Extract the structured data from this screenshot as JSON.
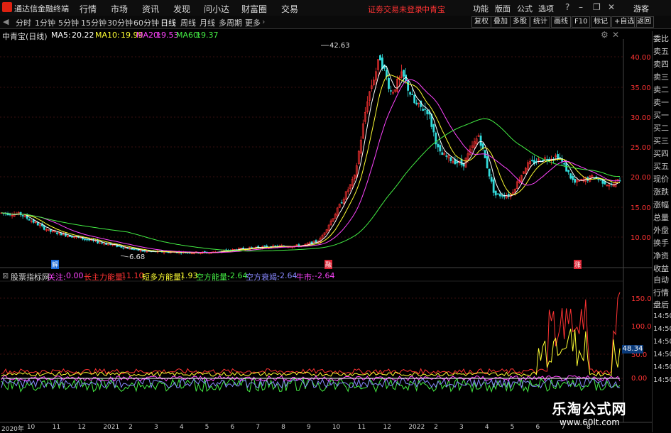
{
  "topbar": {
    "app_name": "通达信金融终端",
    "menus": [
      "行情",
      "市场",
      "资讯",
      "发现",
      "问小达",
      "财富圈",
      "交易"
    ],
    "status_text": "证劵交易未登录",
    "stock_name": "中青宝",
    "right_menus": [
      "功能",
      "版面",
      "公式",
      "选项"
    ],
    "visitor": "游客"
  },
  "toolbar": {
    "periods": [
      "分时",
      "1分钟",
      "5分钟",
      "15分钟",
      "30分钟",
      "60分钟",
      "日线",
      "周线",
      "月线",
      "多周期",
      "更多"
    ],
    "active_period": "日线",
    "right_buttons": [
      "复权",
      "叠加",
      "多股",
      "统计",
      "画线",
      "F10",
      "标记",
      "+自选",
      "返回"
    ]
  },
  "main_chart": {
    "title": "中青宝(日线)",
    "ma": [
      {
        "label": "MA5:",
        "value": "20.22",
        "color": "#ffffff"
      },
      {
        "label": "MA10:",
        "value": "19.99",
        "color": "#ffff33"
      },
      {
        "label": "MA20:",
        "value": "19.53",
        "color": "#ff44ff"
      },
      {
        "label": "MA60:",
        "value": "19.37",
        "color": "#44ee44"
      }
    ],
    "high_label": "42.63",
    "low_label": "6.68",
    "y_ticks": [
      "40.00",
      "35.00",
      "30.00",
      "25.00",
      "20.00",
      "15.00",
      "10.00"
    ],
    "tags": [
      "解",
      "融",
      "涨"
    ]
  },
  "side_panel": {
    "top_labels": [
      "委比",
      "卖五",
      "卖四",
      "卖三",
      "卖二",
      "卖一",
      "买一",
      "买二",
      "买三",
      "买四",
      "买五",
      "现价",
      "涨跌",
      "涨幅",
      "总量",
      "外盘",
      "换手",
      "净资",
      "收益"
    ],
    "bottom_labels": [
      "自动",
      "行情",
      "盘后",
      "14:50",
      "14:50",
      "14:50",
      "14:50",
      "14:50",
      "14:50"
    ]
  },
  "indicator": {
    "name": "股票指标网",
    "items": [
      {
        "label": "关注:",
        "value": "0.00",
        "color": "#ff44ff"
      },
      {
        "label": "长主力能量:",
        "value": "11.10",
        "color": "#ff3333"
      },
      {
        "label": "短多方能量:",
        "value": "1.93",
        "color": "#ffff33"
      },
      {
        "label": "空方能量:",
        "value": "-2.64",
        "color": "#44ee44"
      },
      {
        "label": "空方衰竭:",
        "value": "-2.64",
        "color": "#8888ff"
      },
      {
        "label": "牛市:",
        "value": "-2.64",
        "color": "#ff44ff"
      }
    ],
    "y_ticks": [
      "150.0",
      "100.0",
      "50.0",
      "0.00"
    ],
    "current_value": "48.34"
  },
  "x_axis": {
    "labels": [
      "2020年",
      "10",
      "11",
      "12",
      "2021",
      "2",
      "3",
      "4",
      "5",
      "6",
      "7",
      "8",
      "9",
      "10",
      "11",
      "12",
      "2022",
      "2",
      "3",
      "4",
      "5",
      "6",
      "7",
      "8"
    ]
  },
  "watermark": {
    "line1": "乐淘公式网",
    "line2": "www.60lt.com"
  },
  "colors": {
    "up": "#ff3333",
    "down": "#33dddd",
    "ma5": "#ffffff",
    "ma10": "#ffff33",
    "ma20": "#ff44ff",
    "ma60": "#44ee44"
  }
}
